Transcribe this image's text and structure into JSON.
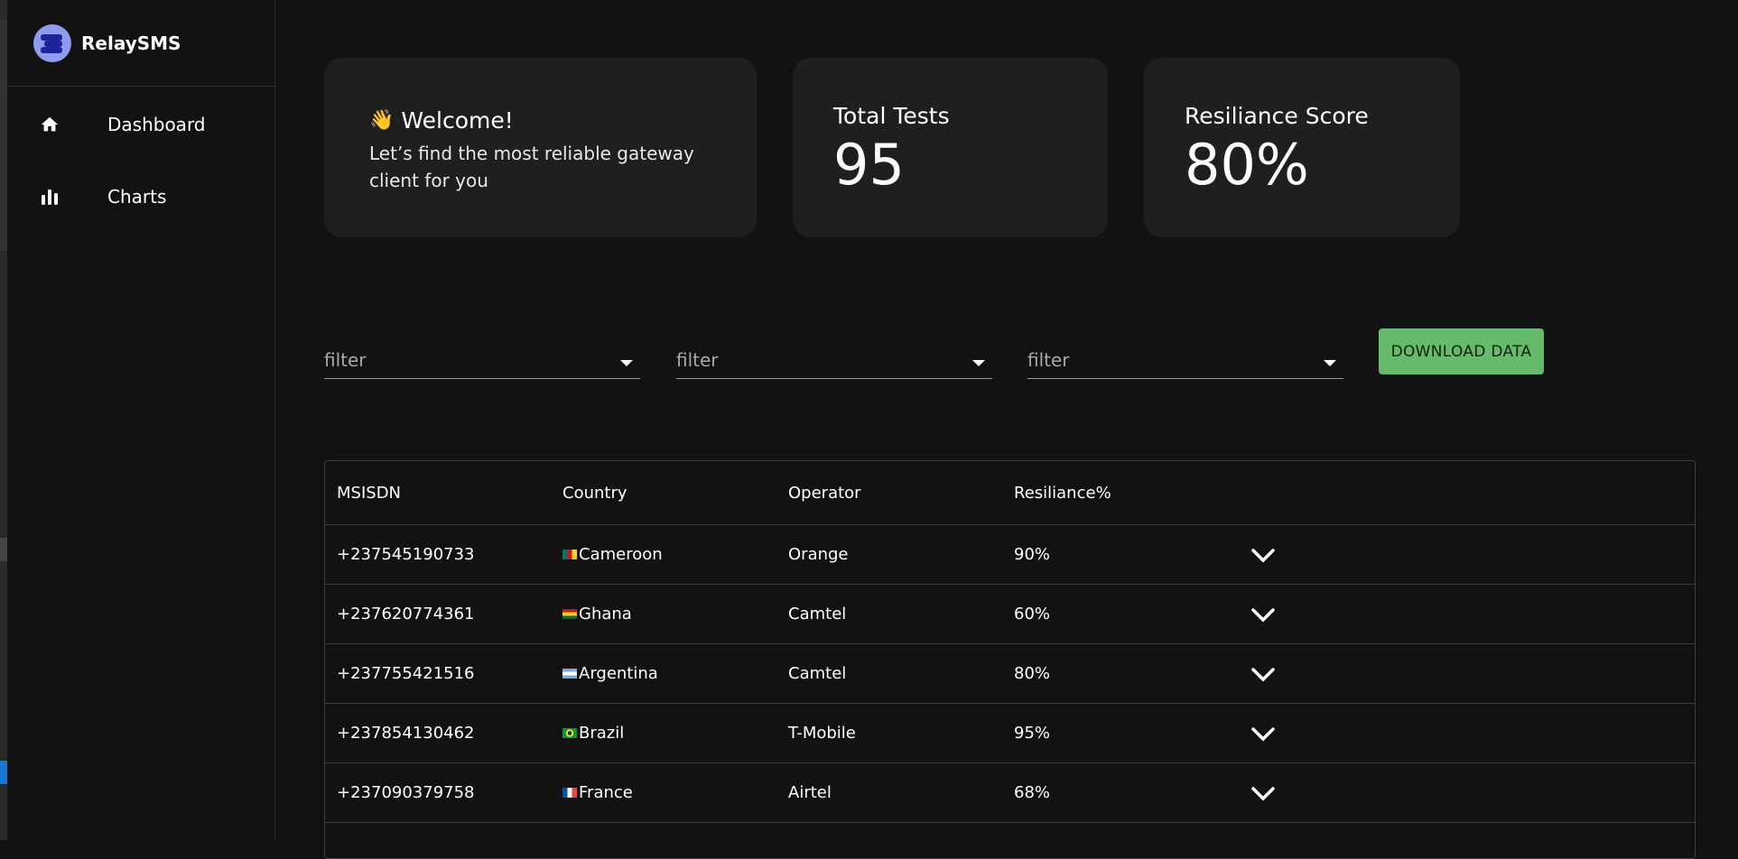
{
  "app": {
    "name": "RelaySMS"
  },
  "sidebar": {
    "items": [
      {
        "label": "Dashboard",
        "icon": "home-icon"
      },
      {
        "label": "Charts",
        "icon": "bar-chart-icon"
      }
    ]
  },
  "cards": {
    "welcome": {
      "title": "Welcome!",
      "text": "Let’s find the most reliable gateway client for you",
      "icon": "waving-hand-icon"
    },
    "total_tests": {
      "label": "Total Tests",
      "value": "95"
    },
    "resiliance": {
      "label": "Resiliance Score",
      "value": "80%"
    }
  },
  "filters": [
    {
      "placeholder": "filter"
    },
    {
      "placeholder": "filter"
    },
    {
      "placeholder": "filter"
    }
  ],
  "download_button": {
    "label": "DOWNLOAD DATA",
    "color": "#66bb6a"
  },
  "table": {
    "columns": [
      "MSISDN",
      "Country",
      "Operator",
      "Resiliance%"
    ],
    "rows": [
      {
        "msisdn": "+237545190733",
        "country": "Cameroon",
        "flag": "cameroon-flag-icon",
        "operator": "Orange",
        "resiliance": "90%"
      },
      {
        "msisdn": "+237620774361",
        "country": "Ghana",
        "flag": "ghana-flag-icon",
        "operator": "Camtel",
        "resiliance": "60%"
      },
      {
        "msisdn": "+237755421516",
        "country": "Argentina",
        "flag": "argentina-flag-icon",
        "operator": "Camtel",
        "resiliance": "80%"
      },
      {
        "msisdn": "+237854130462",
        "country": "Brazil",
        "flag": "brazil-flag-icon",
        "operator": "T-Mobile",
        "resiliance": "95%"
      },
      {
        "msisdn": "+237090379758",
        "country": "France",
        "flag": "france-flag-icon",
        "operator": "Airtel",
        "resiliance": "68%"
      }
    ]
  },
  "colors": {
    "background": "#121212",
    "card": "#1f1f1f",
    "accent": "#66bb6a"
  }
}
